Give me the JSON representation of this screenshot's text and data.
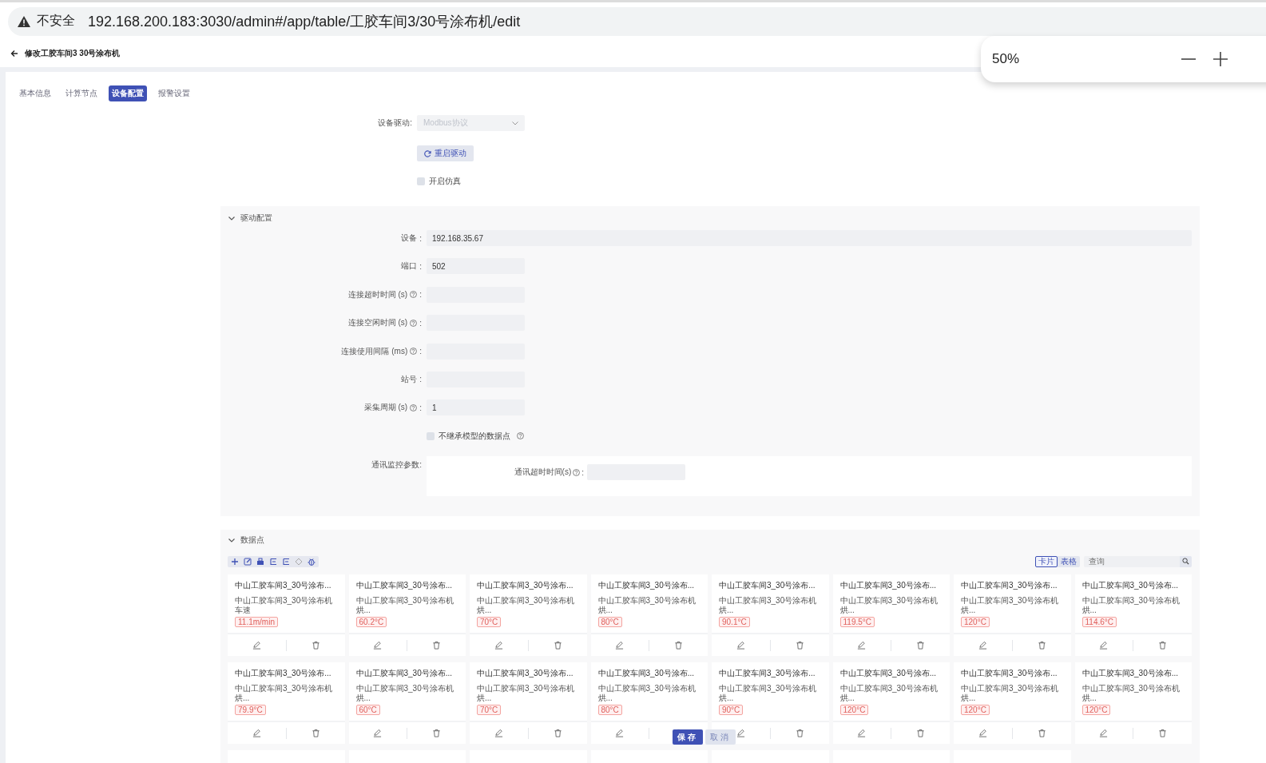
{
  "browser": {
    "security_label": "不安全",
    "url": "192.168.200.183:3030/admin#/app/table/工胶车间3/30号涂布机/edit"
  },
  "zoom_popup": {
    "level": "50%"
  },
  "header": {
    "title": "修改工胶车间3 30号涂布机"
  },
  "tabs": [
    {
      "label": "基本信息",
      "selected": false
    },
    {
      "label": "计算节点",
      "selected": false
    },
    {
      "label": "设备配置",
      "selected": true
    },
    {
      "label": "报警设置",
      "selected": false
    }
  ],
  "driver": {
    "label": "设备驱动:",
    "value": "Modbus协议",
    "disabled": true
  },
  "restart_button": "重启驱动",
  "simulation": {
    "label": "开启仿真",
    "checked": false
  },
  "driver_config": {
    "title": "驱动配置",
    "expanded": true,
    "fields": [
      {
        "label": "设备",
        "help": false,
        "colon": ":",
        "value": "192.168.35.67",
        "wide": true
      },
      {
        "label": "端口",
        "help": false,
        "colon": ":",
        "value": "502",
        "wide": false
      },
      {
        "label": "连接超时时间 (s)",
        "help": true,
        "colon": ":",
        "wide": false
      },
      {
        "label": "连接空闲时间 (s)",
        "help": true,
        "colon": ":",
        "wide": false
      },
      {
        "label": "连接使用间隔 (ms)",
        "help": true,
        "colon": ":",
        "wide": false
      },
      {
        "label": "站号",
        "help": false,
        "colon": ":",
        "wide": false
      },
      {
        "label": "采集周期 (s)",
        "help": true,
        "colon": ":",
        "value": "1",
        "wide": false
      }
    ],
    "inherit": {
      "label": "不继承模型的数据点",
      "checked": false
    },
    "monitor": {
      "label": "通讯监控参数:",
      "fields": [
        {
          "label": "通讯超时时间(s)",
          "help": true,
          "colon": ":"
        }
      ]
    }
  },
  "data_points": {
    "title": "数据点",
    "expanded": true,
    "view_toggle": [
      {
        "label": "卡片",
        "selected": true
      },
      {
        "label": "表格",
        "selected": false
      }
    ],
    "search": {
      "placeholder": "查询"
    },
    "cards": [
      {
        "kind": "card",
        "title": "中山工胶车间3_30号涂布...",
        "subtitle": "中山工胶车间3_30号涂布机车速",
        "value": "11.1m/min"
      },
      {
        "kind": "card",
        "title": "中山工胶车间3_30号涂布...",
        "subtitle": "中山工胶车间3_30号涂布机烘...",
        "value": "60.2°C"
      },
      {
        "kind": "card",
        "title": "中山工胶车间3_30号涂布...",
        "subtitle": "中山工胶车间3_30号涂布机烘...",
        "value": "70°C"
      },
      {
        "kind": "card",
        "title": "中山工胶车间3_30号涂布...",
        "subtitle": "中山工胶车间3_30号涂布机烘...",
        "value": "80°C"
      },
      {
        "kind": "card",
        "title": "中山工胶车间3_30号涂布...",
        "subtitle": "中山工胶车间3_30号涂布机烘...",
        "value": "90.1°C"
      },
      {
        "kind": "card",
        "title": "中山工胶车间3_30号涂布...",
        "subtitle": "中山工胶车间3_30号涂布机烘...",
        "value": "119.5°C"
      },
      {
        "kind": "card",
        "title": "中山工胶车间3_30号涂布...",
        "subtitle": "中山工胶车间3_30号涂布机烘...",
        "value": "120°C"
      },
      {
        "kind": "card",
        "title": "中山工胶车间3_30号涂布...",
        "subtitle": "中山工胶车间3_30号涂布机烘...",
        "value": "114.6°C"
      },
      {
        "kind": "card",
        "title": "中山工胶车间3_30号涂布...",
        "subtitle": "中山工胶车间3_30号涂布机烘...",
        "value": "79.9°C"
      },
      {
        "kind": "card",
        "title": "中山工胶车间3_30号涂布...",
        "subtitle": "中山工胶车间3_30号涂布机烘...",
        "value": "60°C"
      },
      {
        "kind": "card",
        "title": "中山工胶车间3_30号涂布...",
        "subtitle": "中山工胶车间3_30号涂布机烘...",
        "value": "70°C"
      },
      {
        "kind": "card",
        "title": "中山工胶车间3_30号涂布...",
        "subtitle": "中山工胶车间3_30号涂布机烘...",
        "value": "80°C"
      },
      {
        "kind": "card",
        "title": "中山工胶车间3_30号涂布...",
        "subtitle": "中山工胶车间3_30号涂布机烘...",
        "value": "90°C"
      },
      {
        "kind": "card",
        "title": "中山工胶车间3_30号涂布...",
        "subtitle": "中山工胶车间3_30号涂布机烘...",
        "value": "120°C"
      },
      {
        "kind": "card",
        "title": "中山工胶车间3_30号涂布...",
        "subtitle": "中山工胶车间3_30号涂布机烘...",
        "value": "120°C"
      },
      {
        "kind": "card",
        "title": "中山工胶车间3_30号涂布...",
        "subtitle": "中山工胶车间3_30号涂布机烘...",
        "value": "120°C"
      },
      {
        "kind": "cut-off"
      },
      {
        "kind": "cut-off"
      },
      {
        "kind": "cut-off"
      },
      {
        "kind": "cut-off"
      },
      {
        "kind": "cut-off"
      },
      {
        "kind": "cut-off"
      },
      {
        "kind": "cut-off"
      }
    ]
  },
  "actions": {
    "save": "保存",
    "cancel": "取消"
  }
}
